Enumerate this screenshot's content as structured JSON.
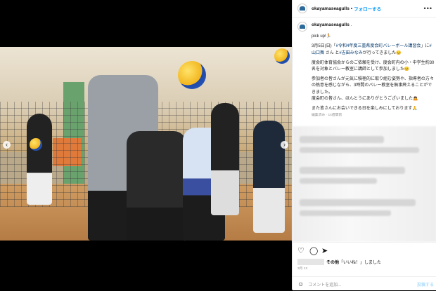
{
  "account": {
    "username": "okayamaseagulls",
    "follow_label": "フォローする",
    "more": "•••",
    "avatar_icon": "seagull-logo-icon"
  },
  "caption": {
    "username": "okayamaseagulls",
    "suffix": ".",
    "line1": "pick up!🏃",
    "line2_a": "3月5日(日)「",
    "line2_link": "#令和4年度三重県度会町バレーボール講習会",
    "line2_b": "」に",
    "line2_link2": "#山口舞",
    "line2_c": "さん と",
    "line2_link3": "#吉田みなみ",
    "line2_d": "が行ってきました😊",
    "para2": "度会町体育協会からのご依頼を受け、度会町内の小・中学生約30名を対象とバレー教室に講師として参加しました😊",
    "para3": "参加者の皆さんが元気に積極的に取り組む姿勢や、指導者の方々の熱意を感じながら、3時間のバレー教室を無事終えることができました。",
    "para4": "度会町の皆さん、ほんとうにありがとうございました🙇",
    "para5": "また皆さんにお会いできる日を楽しみにしております🙏",
    "meta": "編集済み · 14週間前"
  },
  "actions": {
    "like_icon": "heart-icon",
    "comment_icon": "comment-icon",
    "share_icon": "share-icon",
    "likes_text": "その他「いいね！」しました",
    "likes_prefix": "その他",
    "date": "3月 12"
  },
  "comment_box": {
    "emoji_icon": "smile-icon",
    "placeholder": "コメントを追加...",
    "post_label": "投稿する"
  },
  "photo": {
    "prev_icon": "chevron-left-icon",
    "next_icon": "chevron-right-icon"
  }
}
